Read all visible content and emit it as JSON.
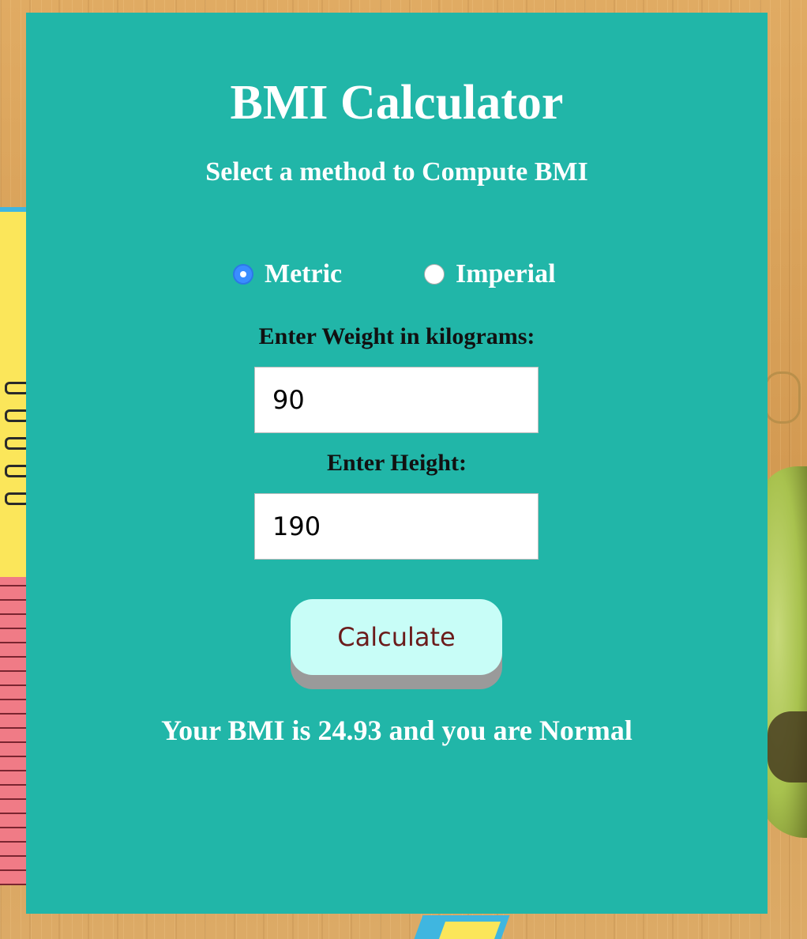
{
  "app": {
    "title": "BMI Calculator",
    "subtitle": "Select a method to Compute BMI"
  },
  "units": {
    "options": [
      {
        "label": "Metric",
        "selected": true
      },
      {
        "label": "Imperial",
        "selected": false
      }
    ]
  },
  "weight": {
    "label": "Enter Weight in kilograms:",
    "value": "90"
  },
  "height": {
    "label": "Enter Height:",
    "value": "190"
  },
  "actions": {
    "calculate_label": "Calculate"
  },
  "result": {
    "text": "Your BMI is 24.93 and you are Normal"
  },
  "colors": {
    "panel": "#21b6a8",
    "button": "#c8fdf7",
    "button_text": "#6b1b1b",
    "radio_selected": "#3a8dff"
  }
}
